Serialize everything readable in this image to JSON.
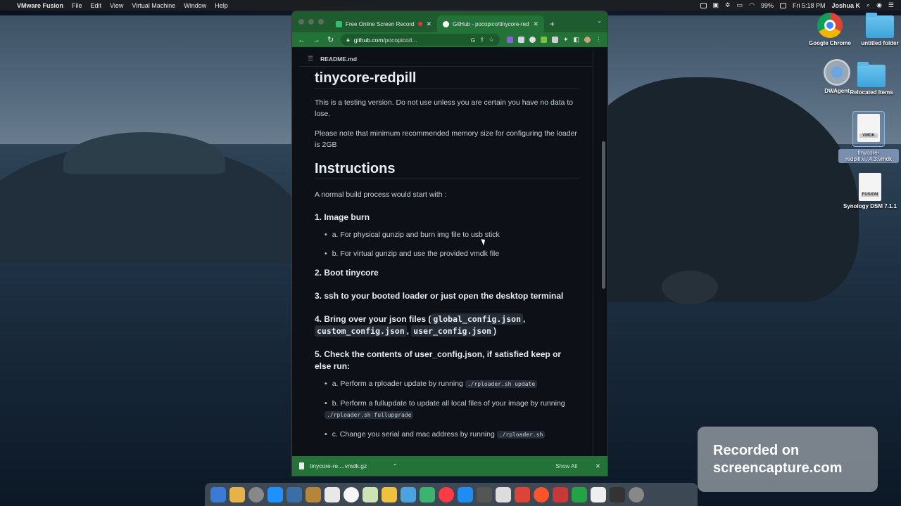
{
  "menubar": {
    "app_name": "VMware Fusion",
    "items": [
      "File",
      "Edit",
      "View",
      "Virtual Machine",
      "Window",
      "Help"
    ],
    "battery": "99%",
    "clock": "Fri 5:18 PM",
    "user": "Joshua K"
  },
  "desktop_icons": [
    {
      "label": "Google Chrome",
      "icon": "chrome-icon"
    },
    {
      "label": "untitled folder",
      "icon": "folder-icon"
    },
    {
      "label": "DWAgent",
      "icon": "gear-icon"
    },
    {
      "label": "Relocated Items",
      "icon": "folder-icon"
    },
    {
      "label": "tinycore-redpill.v...4.3.vmdk",
      "icon": "vmdk-file-icon",
      "badge": "VMDK"
    },
    {
      "label": "Synology DSM 7.1.1",
      "icon": "fusion-file-icon",
      "badge": "FUSION"
    }
  ],
  "browser": {
    "tabs": [
      {
        "title": "Free Online Screen Recorder",
        "favicon_color": "#2fbf71"
      },
      {
        "title": "GitHub - pocopico/tinycore-redpill",
        "favicon_color": "#ffffff"
      }
    ],
    "new_tab": "+",
    "url_host": "github.com",
    "url_path": "/pocopico/t...",
    "readme_label": "README.md"
  },
  "readme": {
    "title": "tinycore-redpill",
    "para1": "This is a testing version. Do not use unless you are certain you have no data to lose.",
    "para2": "Please note that minimum recommended memory size for configuring the loader is 2GB",
    "h2": "Instructions",
    "intro": "A normal build process would start with :",
    "step1": "1. Image burn",
    "step1_a": "a. For physical gunzip and burn img file to usb stick",
    "step1_b": "b. For virtual gunzip and use the provided vmdk file",
    "step2": "2. Boot tinycore",
    "step3": "3. ssh to your booted loader or just open the desktop terminal",
    "step4_prefix": "4. Bring over your json files (",
    "step4_code1": "global_config.json",
    "step4_code2": "custom_config.json",
    "step4_code3": "user_config.json",
    "step5": "5. Check the contents of user_config.json, if satisfied keep or else run:",
    "step5_a_text": "a. Perform a rploader update by running",
    "step5_a_code": "./rploader.sh update",
    "step5_b_text": "b. Perform a fullupdate to update all local files of your image by running",
    "step5_b_code": "./rploader.sh fullupgrade",
    "step5_c_text": "c. Change you serial and mac address by running",
    "step5_c_code": "./rploader.sh"
  },
  "download_bar": {
    "file": "tinycore-re....vmdk.gz",
    "show_all": "Show All"
  },
  "watermark": {
    "line1": "Recorded on",
    "line2": "screencapture.com"
  },
  "dock_colors": [
    "#3a7bd5",
    "#e6b34a",
    "#888",
    "#1e90ff",
    "#3a6ea5",
    "#b5853a",
    "#e8e8e8",
    "#f5f5f5",
    "#cde3b5",
    "#f0c040",
    "#4aa3df",
    "#3cb371",
    "#fc3c44",
    "#1e8cf0",
    "#555",
    "#ddd",
    "#db4437",
    "#fb542b",
    "#c93838",
    "#25a244",
    "#eee",
    "#333",
    "#888"
  ]
}
